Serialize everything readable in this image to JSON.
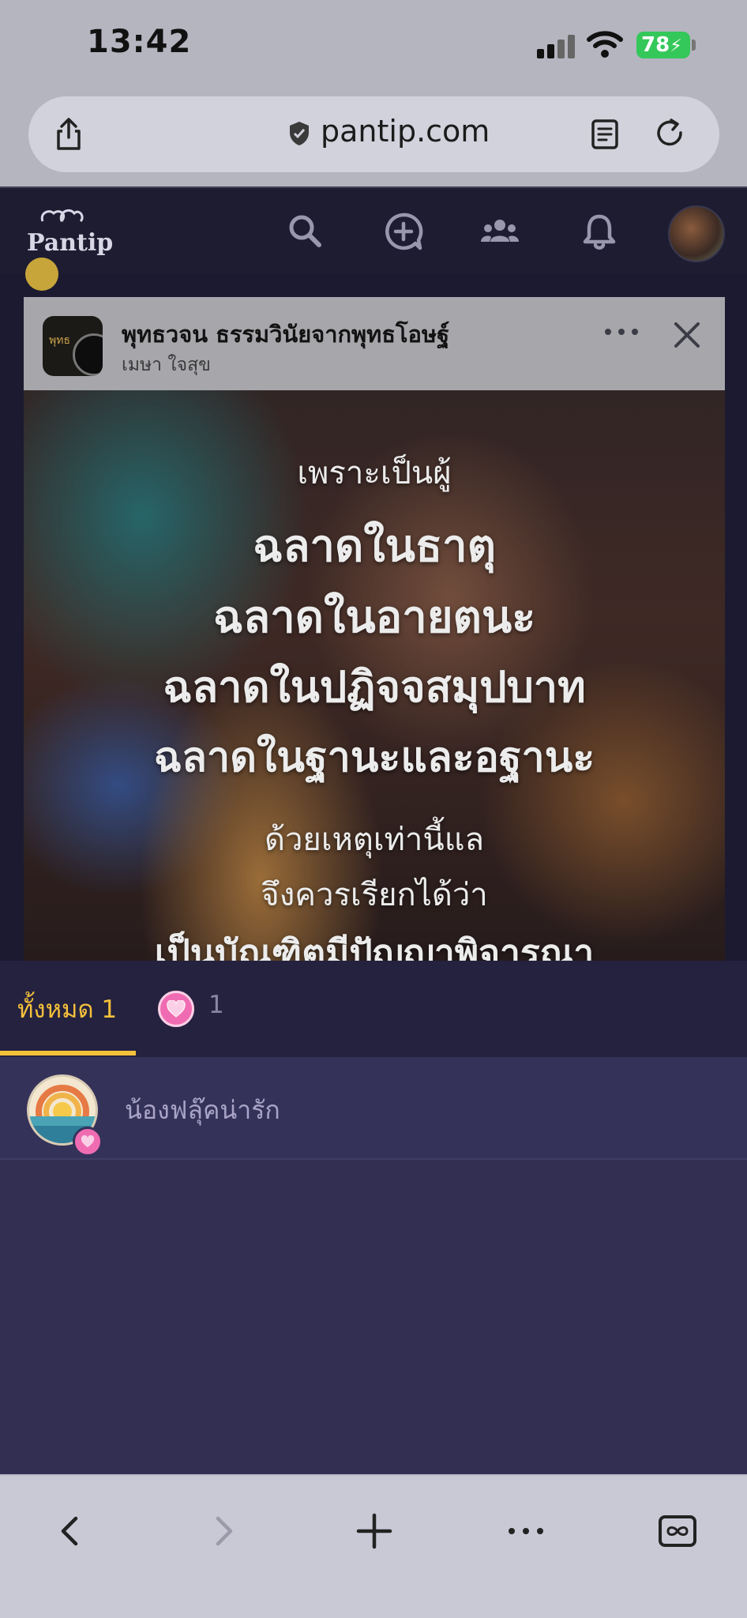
{
  "status_bar": {
    "time": "13:42",
    "battery": "78",
    "battery_color": "#34c759"
  },
  "browser": {
    "domain": "pantip.com",
    "icons": [
      "share-icon",
      "shield-icon",
      "reader-icon",
      "reload-icon"
    ]
  },
  "header": {
    "logo_text": "Pantip",
    "icons": [
      "search-icon",
      "new-topic-icon",
      "community-icon",
      "bell-icon",
      "profile-avatar"
    ]
  },
  "post_card": {
    "page_name": "พุทธวจน ธรรมวินัยจากพุทธโอษฐ์",
    "author": "เมษา ใจสุข",
    "image_text": [
      "เพราะเป็นผู้",
      "ฉลาดในธาตุ",
      "ฉลาดในอายตนะ",
      "ฉลาดในปฏิจจสมุปบาท",
      "ฉลาดในฐานะและอฐานะ",
      "ด้วยเหตุเท่านี้แล",
      "จึงควรเรียกได้ว่า",
      "เป็นบัณฑิตมีปัญญาพิจารณา"
    ]
  },
  "reactions": {
    "tab_all_label": "ทั้งหมด 1",
    "heart_count": "1",
    "accent": "#f5c13a",
    "heart_color": "#f06cb2",
    "users": [
      {
        "name": "น้องฟลุ๊คน่ารัก",
        "reaction": "heart-icon"
      }
    ]
  },
  "toolbar": {
    "icons": [
      "back-icon",
      "forward-icon",
      "new-tab-icon",
      "more-icon",
      "tabs-icon"
    ]
  }
}
